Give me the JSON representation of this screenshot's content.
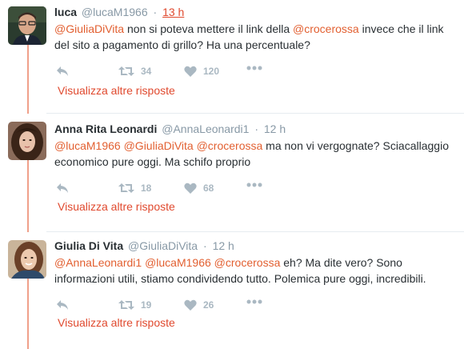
{
  "tweets": [
    {
      "fullname": "luca",
      "username": "@lucaM1966",
      "separator": "·",
      "time": "13 h",
      "text_parts": [
        {
          "mention": "@GiuliaDiVita"
        },
        {
          "text": " non si poteva mettere il link della "
        },
        {
          "mention": "@crocerossa"
        },
        {
          "text": " invece che il link del sito a pagamento di grillo? Ha una percentuale?"
        }
      ],
      "retweets": "34",
      "likes": "120",
      "more_replies": "Visualizza altre risposte"
    },
    {
      "fullname": "Anna Rita Leonardi",
      "username": "@AnnaLeonardi1",
      "separator": "·",
      "time": "12 h",
      "text_parts": [
        {
          "mention": "@lucaM1966"
        },
        {
          "text": " "
        },
        {
          "mention": "@GiuliaDiVita"
        },
        {
          "text": " "
        },
        {
          "mention": "@crocerossa"
        },
        {
          "text": " ma non vi vergognate? Sciacallaggio economico pure oggi. Ma schifo proprio"
        }
      ],
      "retweets": "18",
      "likes": "68",
      "more_replies": "Visualizza altre risposte"
    },
    {
      "fullname": "Giulia Di Vita",
      "username": "@GiuliaDiVita",
      "separator": "·",
      "time": "12 h",
      "text_parts": [
        {
          "mention": "@AnnaLeonardi1"
        },
        {
          "text": " "
        },
        {
          "mention": "@lucaM1966"
        },
        {
          "text": " "
        },
        {
          "mention": "@crocerossa"
        },
        {
          "text": " eh? Ma dite vero? Sono informazioni utili, stiamo condividendo tutto. Polemica pure oggi, incredibili."
        }
      ],
      "retweets": "19",
      "likes": "26",
      "more_replies": "Visualizza altre risposte"
    }
  ],
  "icons": {
    "reply": "reply-icon",
    "retweet": "retweet-icon",
    "like": "heart-icon",
    "more": "more-icon"
  },
  "colors": {
    "mention": "#e25f30",
    "thread_line": "#f0a08a",
    "icon": "#aab8c2"
  }
}
